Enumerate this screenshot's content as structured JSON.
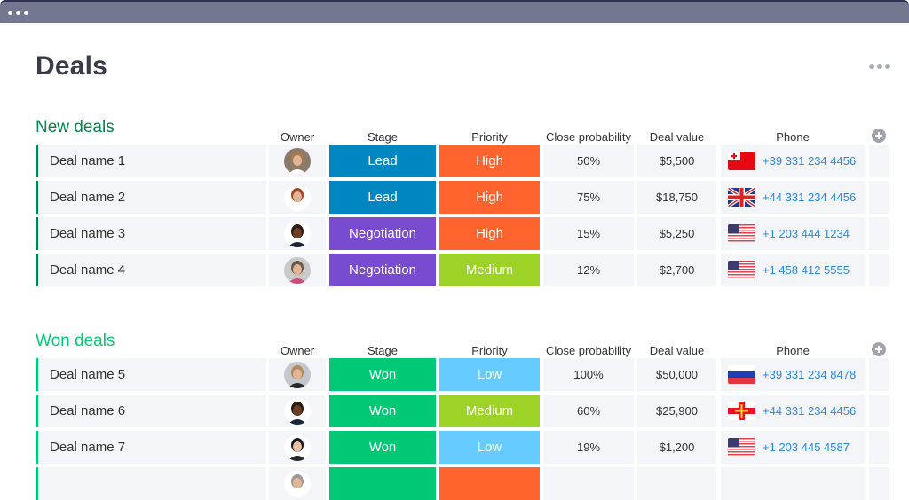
{
  "page": {
    "title": "Deals"
  },
  "columns": [
    "Owner",
    "Stage",
    "Priority",
    "Close probability",
    "Deal value",
    "Phone"
  ],
  "colors": {
    "new_group": "#00854d",
    "won_group": "#00c875",
    "lead": "#0086c0",
    "negotiation": "#784bd1",
    "won": "#00c875",
    "high": "#ff642e",
    "medium": "#9cd326",
    "low": "#66ccff",
    "phone_link": "#2b88e6"
  },
  "groups": [
    {
      "title": "New deals",
      "rows": [
        {
          "name": "Deal name 1",
          "owner": "avatar-woman-blonde",
          "stage": "Lead",
          "priority": "High",
          "close": "50%",
          "value": "$5,500",
          "flag": "tonga-flag",
          "phone": "+39 331 234 4456"
        },
        {
          "name": "Deal name 2",
          "owner": "avatar-woman-red-hair",
          "stage": "Lead",
          "priority": "High",
          "close": "75%",
          "value": "$18,750",
          "flag": "uk-flag",
          "phone": "+44 331 234 4456"
        },
        {
          "name": "Deal name 3",
          "owner": "avatar-man-beard",
          "stage": "Negotiation",
          "priority": "High",
          "close": "15%",
          "value": "$5,250",
          "flag": "us-flag",
          "phone": "+1 203 444 1234"
        },
        {
          "name": "Deal name 4",
          "owner": "avatar-man-bald",
          "stage": "Negotiation",
          "priority": "Medium",
          "close": "12%",
          "value": "$2,700",
          "flag": "us-flag",
          "phone": "+1 458 412 5555"
        }
      ]
    },
    {
      "title": "Won deals",
      "rows": [
        {
          "name": "Deal name 5",
          "owner": "avatar-man-blond",
          "stage": "Won",
          "priority": "Low",
          "close": "100%",
          "value": "$50,000",
          "flag": "russia-flag",
          "phone": "+39 331 234 8478"
        },
        {
          "name": "Deal name 6",
          "owner": "avatar-man-beard",
          "stage": "Won",
          "priority": "Medium",
          "close": "60%",
          "value": "$25,900",
          "flag": "guernsey-flag",
          "phone": "+44 331 234 4456"
        },
        {
          "name": "Deal name 7",
          "owner": "avatar-woman-dark-hair",
          "stage": "Won",
          "priority": "Low",
          "close": "19%",
          "value": "$1,200",
          "flag": "us-flag",
          "phone": "+1 203 445 4587"
        },
        {
          "name": "",
          "owner": "avatar-partial",
          "stage": "",
          "priority": "",
          "close": "",
          "value": "",
          "flag": "",
          "phone": "",
          "stage_color": "won",
          "priority_color": "high"
        }
      ]
    }
  ]
}
